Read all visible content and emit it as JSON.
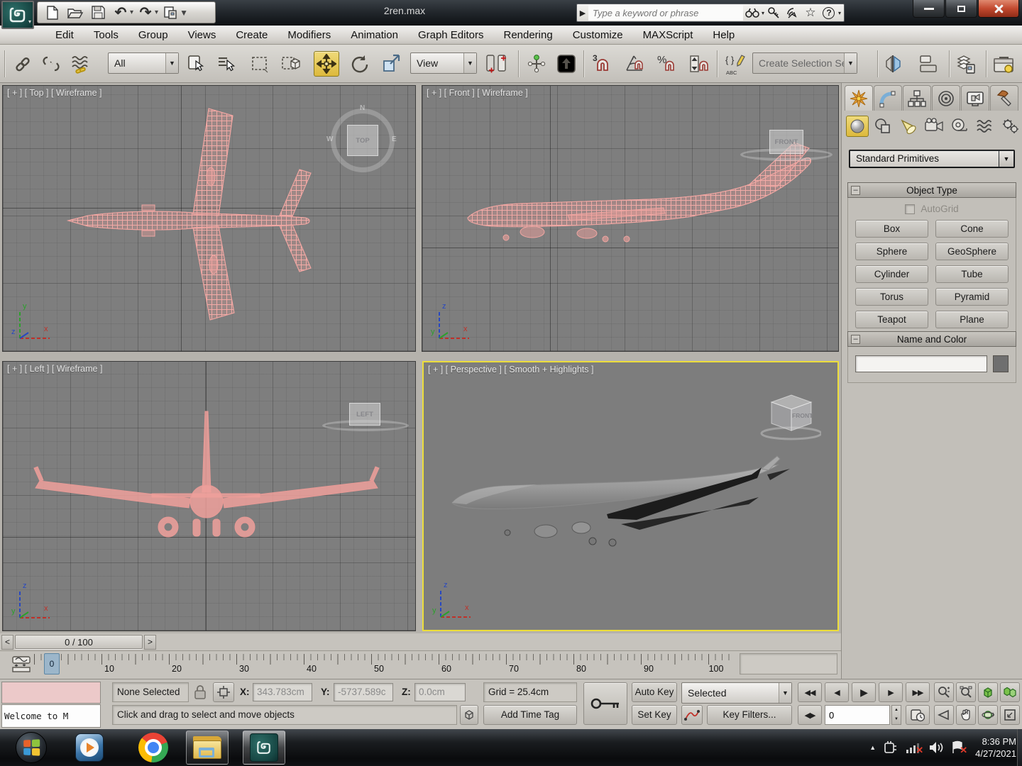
{
  "titlebar": {
    "title": "2ren.max",
    "search_placeholder": "Type a keyword or phrase"
  },
  "menus": [
    "Edit",
    "Tools",
    "Group",
    "Views",
    "Create",
    "Modifiers",
    "Animation",
    "Graph Editors",
    "Rendering",
    "Customize",
    "MAXScript",
    "Help"
  ],
  "toolbar": {
    "filter_value": "All",
    "coord_value": "View",
    "selection_set_value": "Create Selection Se",
    "snap3_label": "3",
    "snap_percent_label": "%",
    "named_sets_sub": "ABC"
  },
  "icons": {
    "chevron_down": "▼",
    "small_arrow": "▾",
    "undo": "↶",
    "redo": "↷",
    "star": "☆",
    "help": "?",
    "search_go": "▶",
    "go_start": "◀◀",
    "prev_frame": "◀",
    "play": "▶",
    "next_frame": "▶",
    "go_end": "▶▶",
    "key_mode": "◀▶",
    "spin_up": "▲",
    "spin_down": "▼",
    "tray_expand": "▲"
  },
  "viewports": {
    "top": {
      "label": "[ + ] [ Top ] [ Wireframe ]",
      "cube": "TOP",
      "ring_n": "N",
      "ring_w": "W",
      "ring_e": "E"
    },
    "front": {
      "label": "[ + ] [ Front ] [ Wireframe ]",
      "cube": "FRONT"
    },
    "left": {
      "label": "[ + ] [ Left ] [ Wireframe ]",
      "cube": "LEFT"
    },
    "perspective": {
      "label": "[ + ] [ Perspective ] [ Smooth + Highlights ]",
      "cube": "FRONT"
    }
  },
  "axis": {
    "x": "x",
    "y": "y",
    "z": "z"
  },
  "command_panel": {
    "category_value": "Standard Primitives",
    "object_type_title": "Object Type",
    "autogrid_label": "AutoGrid",
    "object_buttons": [
      "Box",
      "Cone",
      "Sphere",
      "GeoSphere",
      "Cylinder",
      "Tube",
      "Torus",
      "Pyramid",
      "Teapot",
      "Plane"
    ],
    "name_color_title": "Name and Color",
    "name_value": ""
  },
  "timeline": {
    "frame_display": "0 / 100",
    "prev": "<",
    "next": ">",
    "current_marker": "0",
    "ticks": [
      "0",
      "10",
      "20",
      "30",
      "40",
      "50",
      "60",
      "70",
      "80",
      "90",
      "100"
    ]
  },
  "status_bar": {
    "listener_text": "Welcome to M",
    "selection_status": "None Selected",
    "x_label": "X:",
    "x_value": "343.783cm",
    "y_label": "Y:",
    "y_value": "-5737.589c",
    "z_label": "Z:",
    "z_value": "0.0cm",
    "grid_text": "Grid = 25.4cm",
    "prompt_text": "Click and drag to select and move objects",
    "add_time_tag": "Add Time Tag",
    "auto_key": "Auto Key",
    "set_key": "Set Key",
    "key_filter_scope": "Selected",
    "key_filters": "Key Filters...",
    "frame_field": "0"
  },
  "taskbar": {
    "clock_time": "8:36 PM",
    "clock_date": "4/27/2021"
  },
  "colors": {
    "wireframe_pink": "#f0a6a2",
    "active_viewport_border": "#ecdd3a",
    "move_tool_highlight": "#ddb93c",
    "viewport_bg": "#7e7e7e"
  }
}
